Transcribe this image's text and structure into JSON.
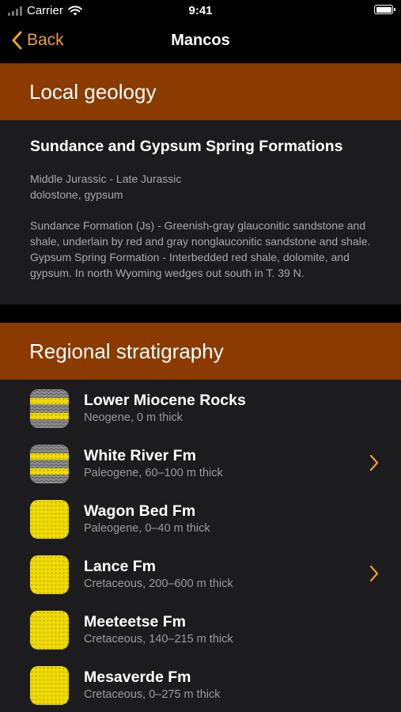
{
  "status": {
    "carrier": "Carrier",
    "time": "9:41"
  },
  "nav": {
    "back_label": "Back",
    "title": "Mancos"
  },
  "local": {
    "header": "Local geology",
    "title": "Sundance and Gypsum Spring Formations",
    "age": "Middle Jurassic - Late Jurassic",
    "lithology": "dolostone, gypsum",
    "description": "Sundance Formation (Js) - Greenish-gray glauconitic sandstone and shale, underlain by red and gray nonglauconitic sandstone and shale.  Gypsum Spring Formation - Interbedded red shale, dolomite, and gypsum.  In north Wyoming wedges out south in T. 39 N."
  },
  "regional": {
    "header": "Regional stratigraphy",
    "items": [
      {
        "name": "Lower Miocene Rocks",
        "detail": "Neogene, 0 m thick",
        "pattern": "banded",
        "chevron": false
      },
      {
        "name": "White River Fm",
        "detail": "Paleogene, 60–100 m thick",
        "pattern": "banded",
        "chevron": true
      },
      {
        "name": "Wagon Bed Fm",
        "detail": "Paleogene, 0–40 m thick",
        "pattern": "yellow",
        "chevron": false
      },
      {
        "name": "Lance Fm",
        "detail": "Cretaceous, 200–600 m thick",
        "pattern": "yellow",
        "chevron": true
      },
      {
        "name": "Meeteetse Fm",
        "detail": "Cretaceous, 140–215 m thick",
        "pattern": "yellow",
        "chevron": false
      },
      {
        "name": "Mesaverde Fm",
        "detail": "Cretaceous, 0–275 m thick",
        "pattern": "yellow",
        "chevron": false
      }
    ]
  },
  "colors": {
    "accent": "#f0a030",
    "section_header": "#8b3a00",
    "swatch_yellow": "#f2dc00",
    "swatch_gray": "#8c8c8c"
  }
}
